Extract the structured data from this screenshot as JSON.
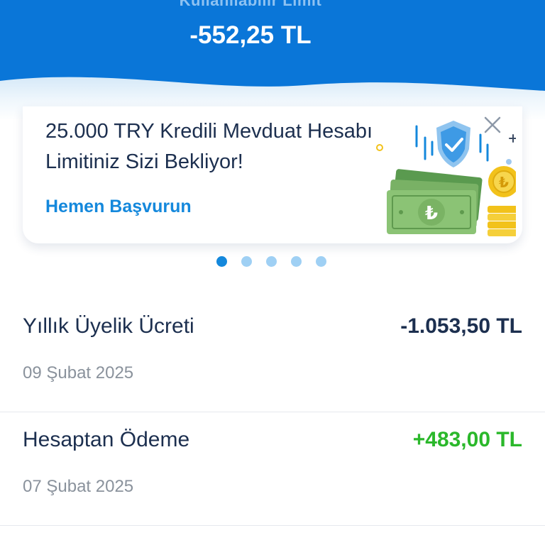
{
  "header": {
    "limit_label": "Kullanılabilir Limit",
    "limit_amount": "-552,25 TL",
    "background_color": "#0a76d8"
  },
  "promo": {
    "title": "25.000 TRY Kredili Mevduat Hesabı Limitiniz Sizi Bekliyor!",
    "link_label": "Hemen Başvurun",
    "illustration_icon": "money-shield-illustration",
    "close_icon": "close-icon",
    "accent_color": "#1488dc"
  },
  "carousel": {
    "page_count": 5,
    "active_index": 0
  },
  "transactions": [
    {
      "title": "Yıllık Üyelik Ücreti",
      "amount": "-1.053,50 TL",
      "date": "09 Şubat 2025",
      "type": "debit"
    },
    {
      "title": "Hesaptan Ödeme",
      "amount": "+483,00 TL",
      "date": "07 Şubat 2025",
      "type": "credit"
    }
  ],
  "colors": {
    "text_primary": "#1c2f4f",
    "text_secondary": "#8a929c",
    "credit": "#2bb82b"
  }
}
